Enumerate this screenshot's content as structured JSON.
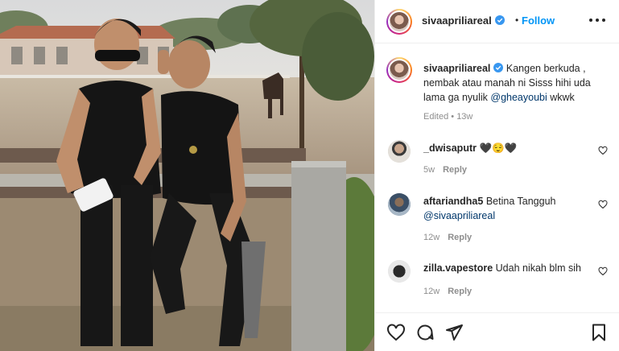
{
  "post": {
    "author": "sivaapriliareal",
    "verified": true,
    "follow_label": "Follow",
    "header_separator": "•",
    "more_icon": "more-horizontal-icon"
  },
  "caption": {
    "username": "sivaapriliareal",
    "text_before": "Kangen berkuda , nembak atau manah ni Sisss hihi uda lama ga nyulik ",
    "mention": "@gheayoubi",
    "text_after": " wkwk",
    "edited": "Edited",
    "separator": "•",
    "time": "13w"
  },
  "comments": [
    {
      "username": "_dwisaputr",
      "text": "🖤😌🖤",
      "mention": "",
      "time": "5w",
      "reply_label": "Reply"
    },
    {
      "username": "aftariandha5",
      "text": "Betina Tangguh",
      "mention": "@sivaapriliareal",
      "time": "12w",
      "reply_label": "Reply"
    },
    {
      "username": "zilla.vapestore",
      "text": "Udah nikah blm sih",
      "mention": "",
      "time": "12w",
      "reply_label": "Reply"
    }
  ],
  "actions": {
    "like_icon": "heart-icon",
    "comment_icon": "comment-icon",
    "share_icon": "send-icon",
    "save_icon": "bookmark-icon"
  },
  "colors": {
    "link_blue": "#0095f6",
    "mention_blue": "#00376b",
    "verified_blue": "#3897f0",
    "muted_text": "#8e8e8e",
    "divider": "#efefef"
  }
}
